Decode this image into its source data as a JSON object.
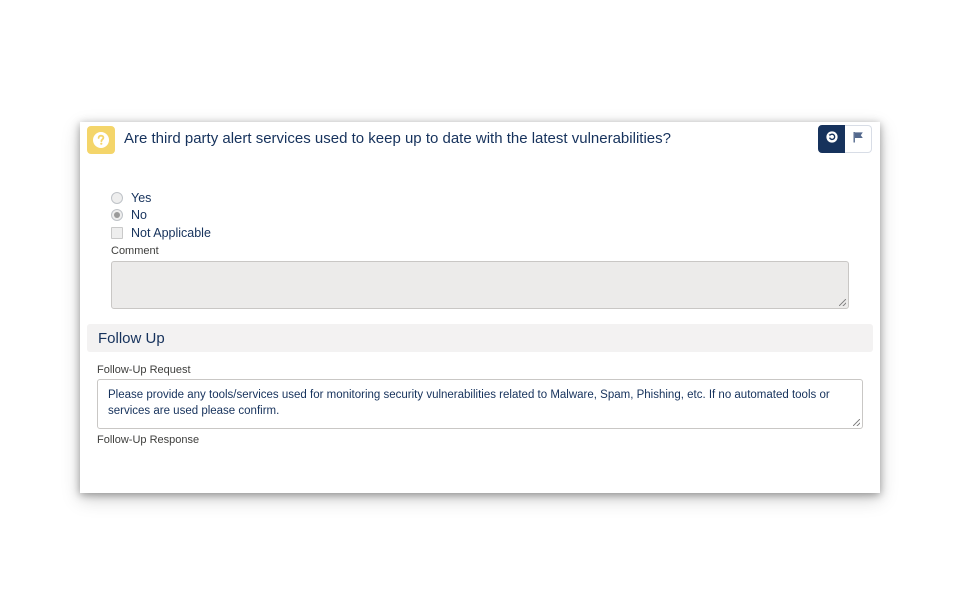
{
  "question": {
    "text": "Are third party alert services used to keep up to date with the latest vulnerabilities?",
    "icon": "question-icon",
    "icon_color": "#f4d56a"
  },
  "actions": {
    "primary_icon": "refresh-icon",
    "primary_color": "#16325c",
    "flag_icon": "flag-icon"
  },
  "options": [
    {
      "label": "Yes",
      "type": "radio",
      "selected": false
    },
    {
      "label": "No",
      "type": "radio",
      "selected": true
    },
    {
      "label": "Not Applicable",
      "type": "checkbox",
      "selected": false
    }
  ],
  "comment": {
    "label": "Comment",
    "value": ""
  },
  "follow_up": {
    "section_title": "Follow Up",
    "request_label": "Follow-Up Request",
    "request_text": "Please provide any tools/services used for monitoring security vulnerabilities related to Malware, Spam, Phishing, etc. If no automated tools or services are used please confirm.",
    "response_label": "Follow-Up Response"
  }
}
